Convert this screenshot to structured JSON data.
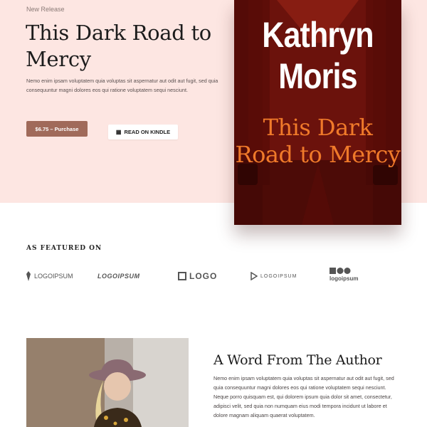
{
  "hero": {
    "eyebrow": "New Release",
    "title": "This Dark Road to Mercy",
    "blurb": "Nemo enim ipsam voluptatem quia voluptas sit aspernatur aut odit aut fugit, sed quia consequuntur magni dolores eos qui ratione voluptatem sequi nesciunt.",
    "purchase_label": "$6.75 – Purchase",
    "kindle_label": "READ ON KINDLE",
    "kindle_icon": "kindle-icon"
  },
  "book": {
    "author": "Kathryn Moris",
    "title": "This Dark Road to Mercy"
  },
  "featured": {
    "label": "AS FEATURED ON",
    "logos": [
      {
        "text": "LOGOIPSUM"
      },
      {
        "text": "LOGOIPSUM"
      },
      {
        "text": "LOGO"
      },
      {
        "text": "LOGOIPSUM"
      },
      {
        "text": "logoipsum"
      }
    ]
  },
  "author_section": {
    "title": "A Word From The Author",
    "body": "Nemo enim ipsam voluptatem quia voluptas sit aspernatur aut odit aut fugit, sed quia consequuntur magni dolores eos qui ratione voluptatem sequi nesciunt. Neque porro quisquam est, qui dolorem ipsum quia dolor sit amet, consectetur, adipisci velit, sed quia non numquam eius modi tempora incidunt ut labore et dolore magnam aliquam quaerat voluptatem."
  },
  "colors": {
    "hero_bg": "#fde6e2",
    "accent": "#a06a5a",
    "book_red": "#8a1a10",
    "book_title": "#f07a2a"
  }
}
